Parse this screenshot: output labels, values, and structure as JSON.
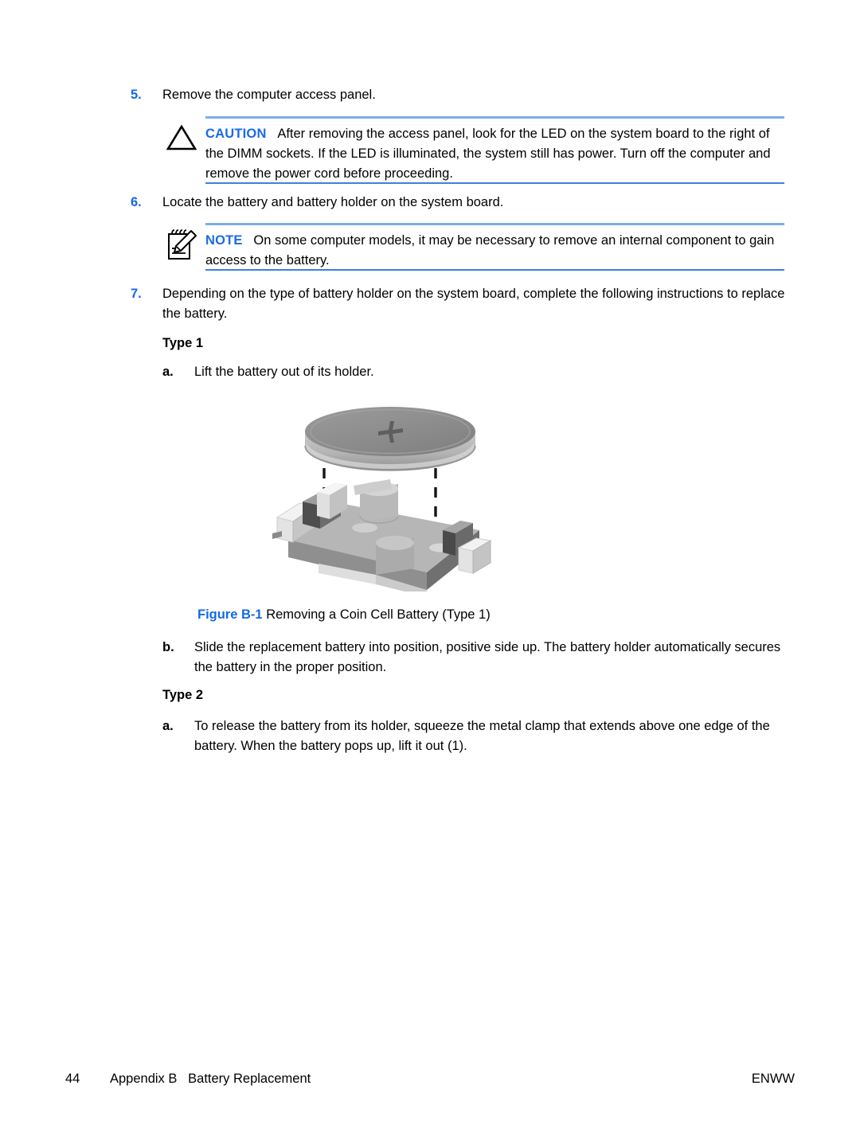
{
  "page": {
    "background": "#ffffff",
    "accent_blue": "#1569e6",
    "rule_top_color": "#7aaee8",
    "rule_bottom_color": "#3f7fe0"
  },
  "steps": [
    {
      "number": "5.",
      "text": "Remove the computer access panel."
    },
    {
      "number": "6.",
      "text": "Locate the battery and battery holder on the system board."
    },
    {
      "number": "7.",
      "text": "Depending on the type of battery holder on the system board, complete the following instructions to replace the battery."
    }
  ],
  "caution": {
    "icon": "caution-triangle-icon",
    "label": "CAUTION",
    "text": "After removing the access panel, look for the LED on the system board to the right of the DIMM sockets. If the LED is illuminated, the system still has power. Turn off the computer and remove the power cord before proceeding."
  },
  "note": {
    "icon": "notepad-pencil-icon",
    "label": "NOTE",
    "text": "On some computer models, it may be necessary to remove an internal component to gain access to the battery."
  },
  "type1": {
    "heading": "Type 1",
    "substeps": [
      {
        "letter": "a.",
        "text": "Lift the battery out of its holder."
      },
      {
        "letter": "b.",
        "text": "Slide the replacement battery into position, positive side up. The battery holder automatically secures the battery in the proper position."
      }
    ]
  },
  "type2": {
    "heading": "Type 2",
    "substeps": [
      {
        "letter": "a.",
        "text": "To release the battery from its holder, squeeze the metal clamp that extends above one edge of the battery. When the battery pops up, lift it out (1)."
      }
    ]
  },
  "figure": {
    "illustration": "coin-cell-battery-and-holder-illustration",
    "caption_number": "Figure B-1",
    "caption_text": "Removing a Coin Cell Battery (Type 1)",
    "battery_marking": "+"
  },
  "footer": {
    "page_number": "44",
    "chapter": "Appendix B   Battery Replacement",
    "locale": "ENWW"
  }
}
